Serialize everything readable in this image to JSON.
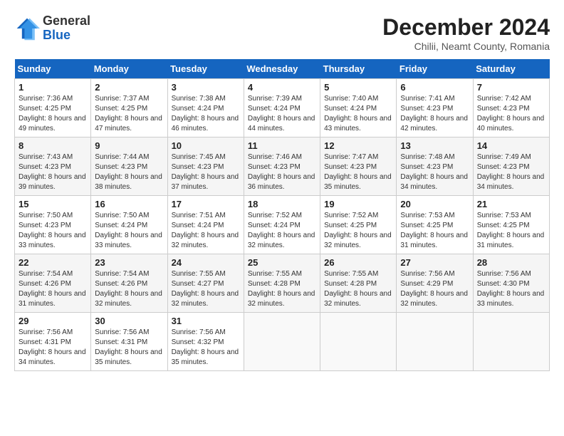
{
  "header": {
    "logo_general": "General",
    "logo_blue": "Blue",
    "month_title": "December 2024",
    "location": "Chilii, Neamt County, Romania"
  },
  "days_of_week": [
    "Sunday",
    "Monday",
    "Tuesday",
    "Wednesday",
    "Thursday",
    "Friday",
    "Saturday"
  ],
  "weeks": [
    [
      {
        "day": "1",
        "sunrise": "7:36 AM",
        "sunset": "4:25 PM",
        "daylight": "8 hours and 49 minutes."
      },
      {
        "day": "2",
        "sunrise": "7:37 AM",
        "sunset": "4:25 PM",
        "daylight": "8 hours and 47 minutes."
      },
      {
        "day": "3",
        "sunrise": "7:38 AM",
        "sunset": "4:24 PM",
        "daylight": "8 hours and 46 minutes."
      },
      {
        "day": "4",
        "sunrise": "7:39 AM",
        "sunset": "4:24 PM",
        "daylight": "8 hours and 44 minutes."
      },
      {
        "day": "5",
        "sunrise": "7:40 AM",
        "sunset": "4:24 PM",
        "daylight": "8 hours and 43 minutes."
      },
      {
        "day": "6",
        "sunrise": "7:41 AM",
        "sunset": "4:23 PM",
        "daylight": "8 hours and 42 minutes."
      },
      {
        "day": "7",
        "sunrise": "7:42 AM",
        "sunset": "4:23 PM",
        "daylight": "8 hours and 40 minutes."
      }
    ],
    [
      {
        "day": "8",
        "sunrise": "7:43 AM",
        "sunset": "4:23 PM",
        "daylight": "8 hours and 39 minutes."
      },
      {
        "day": "9",
        "sunrise": "7:44 AM",
        "sunset": "4:23 PM",
        "daylight": "8 hours and 38 minutes."
      },
      {
        "day": "10",
        "sunrise": "7:45 AM",
        "sunset": "4:23 PM",
        "daylight": "8 hours and 37 minutes."
      },
      {
        "day": "11",
        "sunrise": "7:46 AM",
        "sunset": "4:23 PM",
        "daylight": "8 hours and 36 minutes."
      },
      {
        "day": "12",
        "sunrise": "7:47 AM",
        "sunset": "4:23 PM",
        "daylight": "8 hours and 35 minutes."
      },
      {
        "day": "13",
        "sunrise": "7:48 AM",
        "sunset": "4:23 PM",
        "daylight": "8 hours and 34 minutes."
      },
      {
        "day": "14",
        "sunrise": "7:49 AM",
        "sunset": "4:23 PM",
        "daylight": "8 hours and 34 minutes."
      }
    ],
    [
      {
        "day": "15",
        "sunrise": "7:50 AM",
        "sunset": "4:23 PM",
        "daylight": "8 hours and 33 minutes."
      },
      {
        "day": "16",
        "sunrise": "7:50 AM",
        "sunset": "4:24 PM",
        "daylight": "8 hours and 33 minutes."
      },
      {
        "day": "17",
        "sunrise": "7:51 AM",
        "sunset": "4:24 PM",
        "daylight": "8 hours and 32 minutes."
      },
      {
        "day": "18",
        "sunrise": "7:52 AM",
        "sunset": "4:24 PM",
        "daylight": "8 hours and 32 minutes."
      },
      {
        "day": "19",
        "sunrise": "7:52 AM",
        "sunset": "4:25 PM",
        "daylight": "8 hours and 32 minutes."
      },
      {
        "day": "20",
        "sunrise": "7:53 AM",
        "sunset": "4:25 PM",
        "daylight": "8 hours and 31 minutes."
      },
      {
        "day": "21",
        "sunrise": "7:53 AM",
        "sunset": "4:25 PM",
        "daylight": "8 hours and 31 minutes."
      }
    ],
    [
      {
        "day": "22",
        "sunrise": "7:54 AM",
        "sunset": "4:26 PM",
        "daylight": "8 hours and 31 minutes."
      },
      {
        "day": "23",
        "sunrise": "7:54 AM",
        "sunset": "4:26 PM",
        "daylight": "8 hours and 32 minutes."
      },
      {
        "day": "24",
        "sunrise": "7:55 AM",
        "sunset": "4:27 PM",
        "daylight": "8 hours and 32 minutes."
      },
      {
        "day": "25",
        "sunrise": "7:55 AM",
        "sunset": "4:28 PM",
        "daylight": "8 hours and 32 minutes."
      },
      {
        "day": "26",
        "sunrise": "7:55 AM",
        "sunset": "4:28 PM",
        "daylight": "8 hours and 32 minutes."
      },
      {
        "day": "27",
        "sunrise": "7:56 AM",
        "sunset": "4:29 PM",
        "daylight": "8 hours and 32 minutes."
      },
      {
        "day": "28",
        "sunrise": "7:56 AM",
        "sunset": "4:30 PM",
        "daylight": "8 hours and 33 minutes."
      }
    ],
    [
      {
        "day": "29",
        "sunrise": "7:56 AM",
        "sunset": "4:31 PM",
        "daylight": "8 hours and 34 minutes."
      },
      {
        "day": "30",
        "sunrise": "7:56 AM",
        "sunset": "4:31 PM",
        "daylight": "8 hours and 35 minutes."
      },
      {
        "day": "31",
        "sunrise": "7:56 AM",
        "sunset": "4:32 PM",
        "daylight": "8 hours and 35 minutes."
      },
      null,
      null,
      null,
      null
    ]
  ]
}
